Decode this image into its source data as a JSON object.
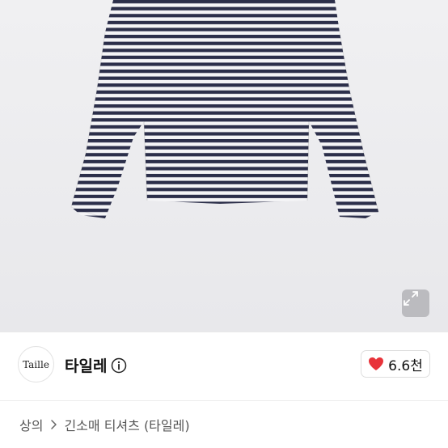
{
  "product": {
    "image": "striped long-sleeve t-shirt"
  },
  "shop": {
    "logo_text": "Taille",
    "name": "타일레"
  },
  "like": {
    "count": "6.6천",
    "color": "#e8333a"
  },
  "breadcrumb": {
    "category": "상의",
    "product": "긴소매 티셔츠 (타일레)"
  },
  "icons": {
    "expand": "expand-icon",
    "info": "info-icon",
    "heart": "heart-icon",
    "chevron": "chevron-right-icon"
  }
}
